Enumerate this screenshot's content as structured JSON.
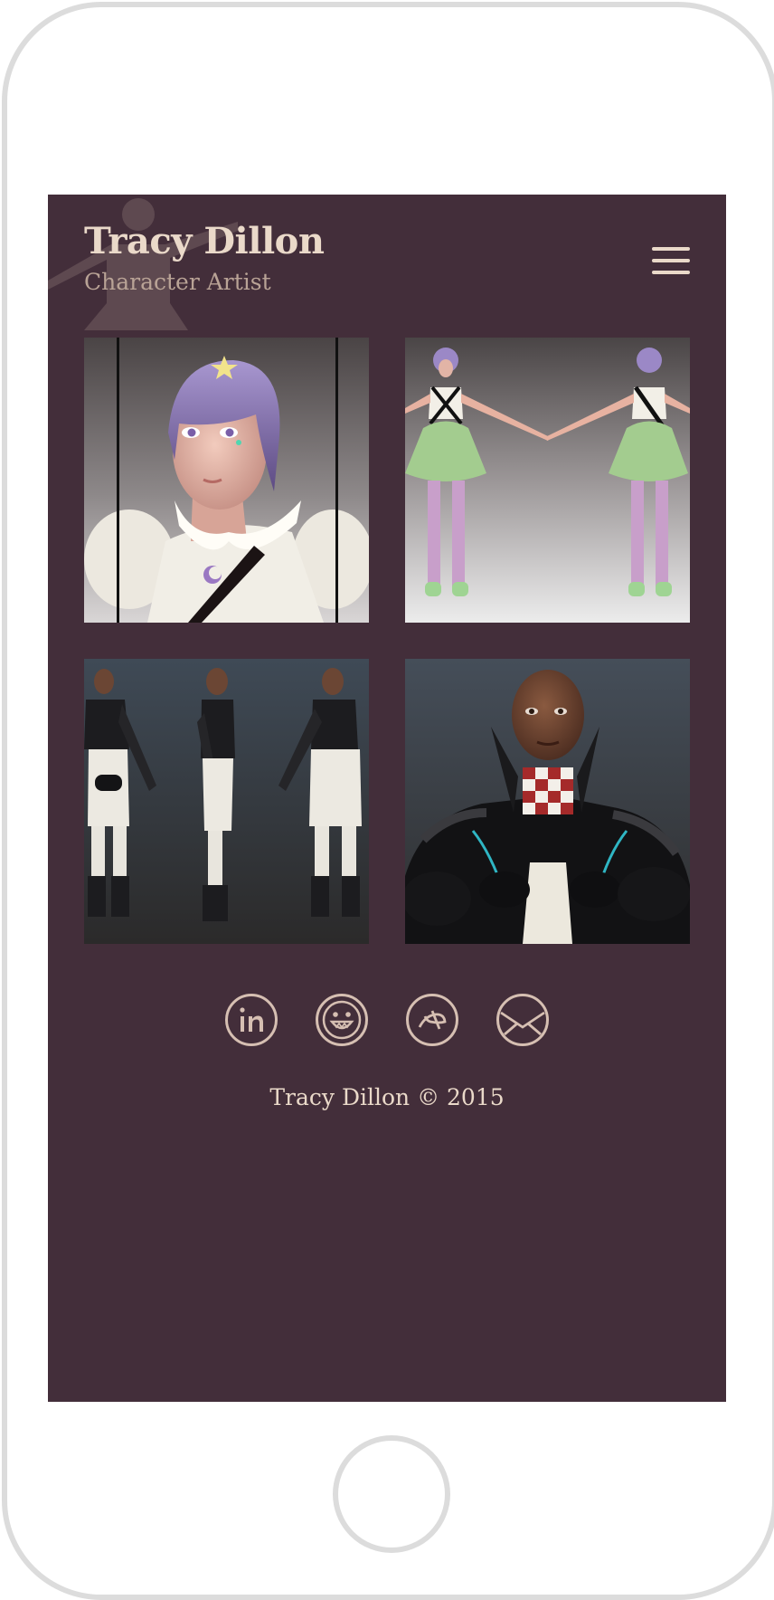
{
  "site": {
    "title": "Tracy Dillon",
    "subtitle": "Character Artist"
  },
  "header": {
    "menu_icon": "hamburger-menu-icon"
  },
  "gallery": {
    "items": [
      {
        "subject": "purple-haired-girl-closeup",
        "icon": "artwork-thumbnail"
      },
      {
        "subject": "purple-haired-girl-turnaround",
        "icon": "artwork-thumbnail"
      },
      {
        "subject": "dark-armored-character-turnaround",
        "icon": "artwork-thumbnail"
      },
      {
        "subject": "dark-armored-character-closeup",
        "icon": "artwork-thumbnail"
      }
    ]
  },
  "social": [
    {
      "name": "LinkedIn",
      "icon": "linkedin-icon"
    },
    {
      "name": "Smile",
      "icon": "smiley-icon"
    },
    {
      "name": "deviantArt",
      "icon": "dribbble-icon"
    },
    {
      "name": "Email",
      "icon": "envelope-icon"
    }
  ],
  "footer": {
    "copyright": "Tracy Dillon © 2015"
  },
  "colors": {
    "background": "#432e3a",
    "title_text": "#ead9c9",
    "subtitle_text": "#b9a396",
    "icon_stroke": "#d6bfb2",
    "device_frame": "#dcdcdc"
  }
}
